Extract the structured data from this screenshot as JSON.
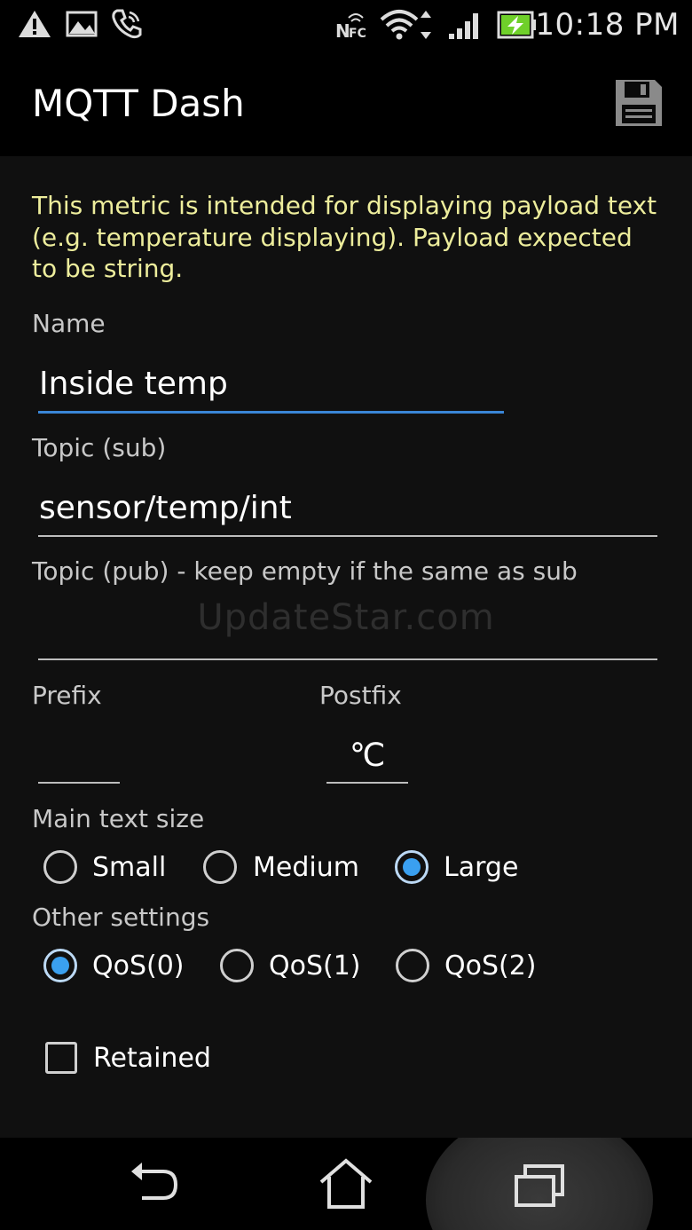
{
  "status_bar": {
    "time": "10:18 PM",
    "icons": [
      "warning-icon",
      "image-icon",
      "phone-icon",
      "nfc-icon",
      "wifi-icon",
      "signal-icon",
      "battery-charging-icon"
    ],
    "nfc_label": "NFC"
  },
  "action_bar": {
    "title": "MQTT Dash",
    "save_icon": "save-icon"
  },
  "form": {
    "description": "This metric is intended for displaying payload text (e.g. temperature displaying). Payload expected to be string.",
    "name_label": "Name",
    "name_value": "Inside temp",
    "topic_sub_label": "Topic (sub)",
    "topic_sub_value": "sensor/temp/int",
    "topic_pub_label": "Topic (pub) - keep empty if the same as sub",
    "topic_pub_value": "",
    "watermark": "UpdateStar.com",
    "prefix_label": "Prefix",
    "prefix_value": "",
    "postfix_label": "Postfix",
    "postfix_value": "℃",
    "main_text_size_label": "Main text size",
    "text_sizes": [
      {
        "label": "Small",
        "checked": false
      },
      {
        "label": "Medium",
        "checked": false
      },
      {
        "label": "Large",
        "checked": true
      }
    ],
    "other_settings_label": "Other settings",
    "qos_options": [
      {
        "label": "QoS(0)",
        "checked": true
      },
      {
        "label": "QoS(1)",
        "checked": false
      },
      {
        "label": "QoS(2)",
        "checked": false
      }
    ],
    "retained_label": "Retained",
    "retained_checked": false
  },
  "nav_bar": {
    "icons": [
      "back-icon",
      "home-icon",
      "recent-apps-icon"
    ]
  },
  "colors": {
    "accent": "#3aa0f0",
    "focus_underline": "#3a86d6",
    "description_text": "#eded9c",
    "battery": "#6fd02a"
  }
}
